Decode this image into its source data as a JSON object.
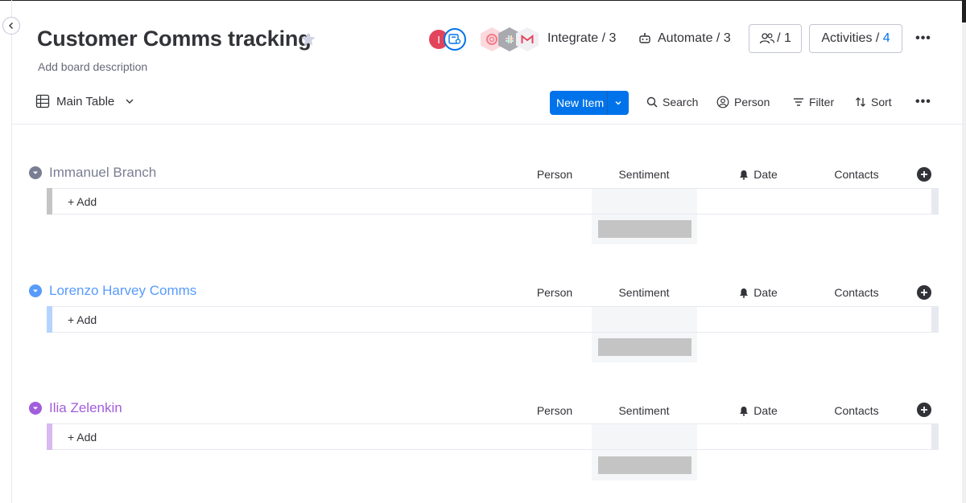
{
  "board": {
    "title": "Customer Comms tracking",
    "description": "Add board description"
  },
  "header": {
    "avatar_initial": "I",
    "integrate_label": "Integrate / 3",
    "automate_label": "Automate / 3",
    "invite_count": "/ 1",
    "activities_label": "Activities / ",
    "activities_count": "4",
    "more_glyph": "•••"
  },
  "view": {
    "tab_label": "Main Table"
  },
  "toolbar": {
    "new_item_label": "New Item",
    "search_label": "Search",
    "person_label": "Person",
    "filter_label": "Filter",
    "sort_label": "Sort",
    "more_glyph": "•••"
  },
  "columns": [
    "Person",
    "Sentiment",
    "Date",
    "Contacts"
  ],
  "groups": [
    {
      "title": "Immanuel Branch",
      "color": "#797e93",
      "bar_color": "#c4c4c4",
      "add_label": "+ Add"
    },
    {
      "title": "Lorenzo Harvey Comms",
      "color": "#579bfc",
      "bar_color": "#b5d3fe",
      "add_label": "+ Add"
    },
    {
      "title": "Ilia Zelenkin",
      "color": "#a25ddc",
      "bar_color": "#d9b9f2",
      "add_label": "+ Add"
    }
  ],
  "colors": {
    "primary": "#0073ea",
    "text": "#323338",
    "muted": "#676879"
  }
}
